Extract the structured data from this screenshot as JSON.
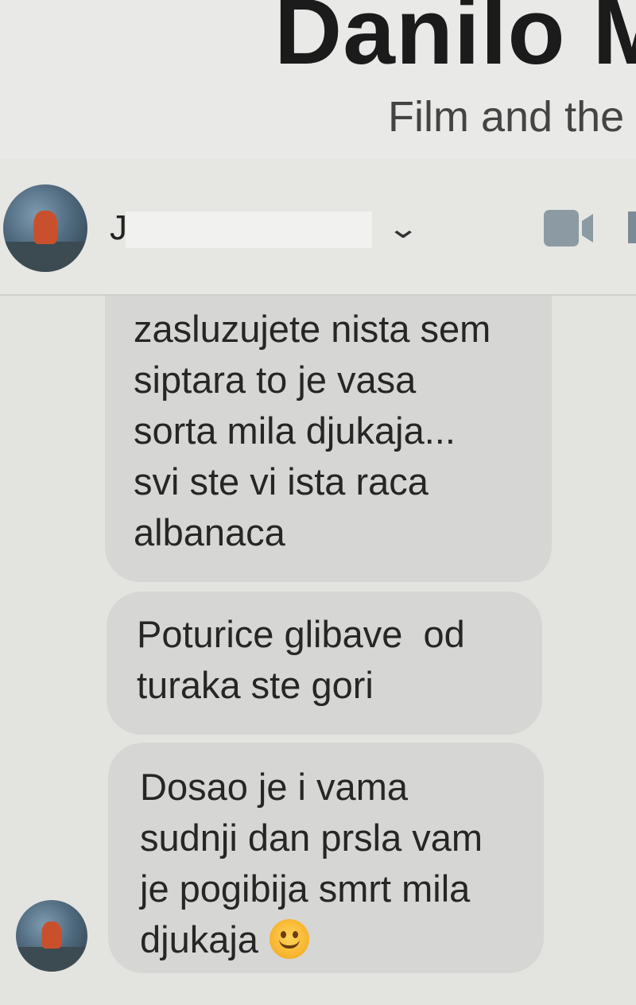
{
  "profile": {
    "name": "Danilo M",
    "subtitle": "Film and the"
  },
  "header": {
    "contact_name_visible": "J",
    "icons": [
      "avatar",
      "chevron-down-icon",
      "video-call-icon"
    ]
  },
  "messages": [
    {
      "lines": [
        "zasluzujete nista sem",
        "siptara to je vasa",
        "sorta mila djukaja...",
        "svi ste vi ista raca",
        "albanaca"
      ]
    },
    {
      "lines": [
        "Poturice glibave  od",
        "turaka ste gori"
      ]
    },
    {
      "lines": [
        "Dosao je i vama",
        "sudnji dan prsla vam",
        "je pogibija smrt mila",
        "djukaja"
      ],
      "trailing_emoji": "smiley-emoji-icon"
    }
  ],
  "colors": {
    "bubble": "#d6d6d4",
    "background": "#e3e3e0",
    "video_icon": "#8c9aa3"
  }
}
